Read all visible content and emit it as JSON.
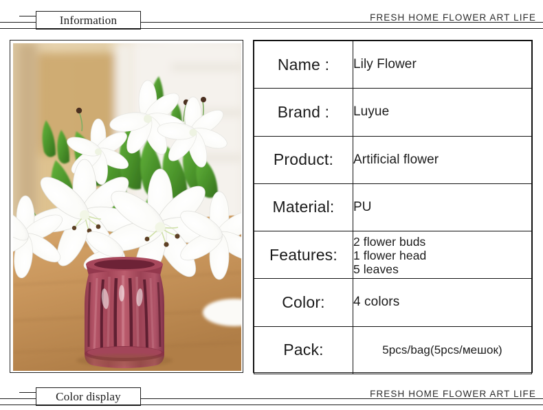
{
  "header": {
    "section_label": "Information",
    "tagline": "FRESH HOME FLOWER ART LIFE"
  },
  "footer": {
    "section_label": "Color display",
    "tagline": "FRESH HOME FLOWER ART LIFE"
  },
  "photo": {
    "alt": "White lily artificial flowers in a ribbed rose-colored glass vase on a wooden table",
    "colors": {
      "background_warm": "#e8d6b8",
      "background_light": "#f4f0ea",
      "table_wood": "#c89a62",
      "vase_rose": "#a8485c",
      "vase_dark": "#5e2330",
      "leaf_green": "#4f9a2e",
      "petal_white": "#fdfdfb"
    }
  },
  "spec_table": {
    "rows": [
      {
        "label": "Name :",
        "value": "Lily Flower",
        "style": "single"
      },
      {
        "label": "Brand :",
        "value": "Luyue",
        "style": "single"
      },
      {
        "label": "Product:",
        "value": "Artificial flower",
        "style": "single"
      },
      {
        "label": "Material:",
        "value": "PU",
        "style": "single"
      },
      {
        "label": "Features:",
        "value": "2 flower buds\n1 flower head\n5 leaves",
        "style": "multiline",
        "lines": [
          "2 flower buds",
          "1 flower head",
          "5 leaves"
        ]
      },
      {
        "label": "Color:",
        "value": "4 colors",
        "style": "single"
      },
      {
        "label": "Pack:",
        "value": "5pcs/bag(5pcs/мешок)",
        "style": "centered"
      }
    ]
  },
  "theme": {
    "ink": "#1a1a1a",
    "rule": "#111111",
    "page_background": "#ffffff"
  }
}
